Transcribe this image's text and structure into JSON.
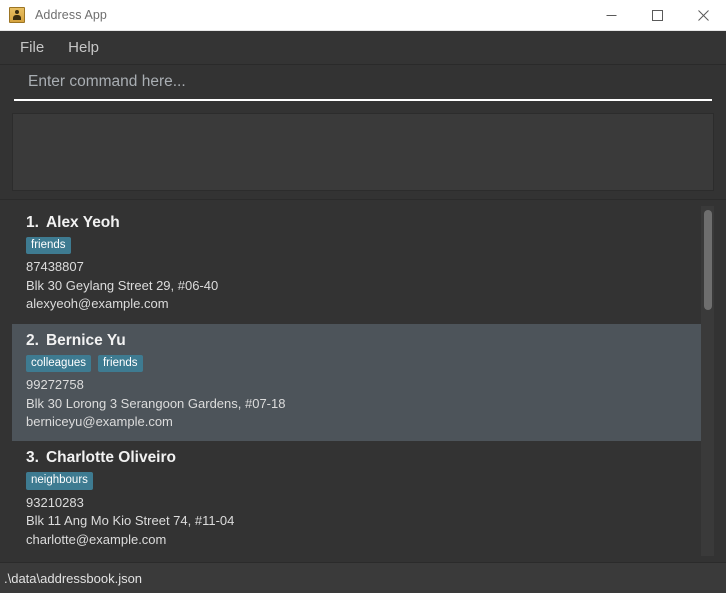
{
  "window": {
    "title": "Address App",
    "icon": "address-book-icon",
    "controls": {
      "minimize": "—",
      "maximize": "□",
      "close": "✕"
    }
  },
  "menu": {
    "items": [
      {
        "label": "File"
      },
      {
        "label": "Help"
      }
    ]
  },
  "command": {
    "placeholder": "Enter command here...",
    "value": ""
  },
  "result": {
    "text": ""
  },
  "person_list": {
    "persons": [
      {
        "index": "1.",
        "name": "Alex Yeoh",
        "tags": [
          "friends"
        ],
        "phone": "87438807",
        "address": "Blk 30 Geylang Street 29, #06-40",
        "email": "alexyeoh@example.com"
      },
      {
        "index": "2.",
        "name": "Bernice Yu",
        "tags": [
          "colleagues",
          "friends"
        ],
        "phone": "99272758",
        "address": "Blk 30 Lorong 3 Serangoon Gardens, #07-18",
        "email": "berniceyu@example.com"
      },
      {
        "index": "3.",
        "name": "Charlotte Oliveiro",
        "tags": [
          "neighbours"
        ],
        "phone": "93210283",
        "address": "Blk 11 Ang Mo Kio Street 74, #11-04",
        "email": "charlotte@example.com"
      }
    ]
  },
  "status": {
    "file_path": ".\\data\\addressbook.json"
  },
  "colors": {
    "tag_background": "#3e7b91",
    "card_background": "#333333",
    "card_background_alt": "#4d545a",
    "panel_background": "#3a3a3a",
    "title_bar_background": "#ffffff",
    "accent_underline": "#ffffff"
  }
}
